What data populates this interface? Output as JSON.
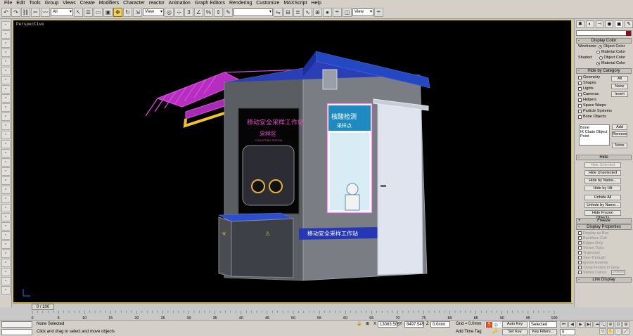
{
  "menu": [
    "File",
    "Edit",
    "Tools",
    "Group",
    "Views",
    "Create",
    "Modifiers",
    "Character",
    "reactor",
    "Animation",
    "Graph Editors",
    "Rendering",
    "Customize",
    "MAXScript",
    "Help"
  ],
  "toolbar": {
    "filter_value": "All",
    "refcoord_value": "View",
    "named_selection_value": "",
    "view_dropdown2": "View"
  },
  "viewport": {
    "label": "Perspective",
    "model": {
      "poster_left_title": "移动安全采样工作站",
      "poster_left_sub": "采样区",
      "poster_left_small": "COLLECTING STATION",
      "poster_right_title": "核酸检测",
      "poster_right_sub": "采样点",
      "banner_text": "移动安全采样工作站"
    }
  },
  "right_panel": {
    "display_color": {
      "header": "Display Color",
      "wireframe_label": "Wireframe:",
      "shaded_label": "Shaded:",
      "opt_object": "Object Color",
      "opt_material": "Material Color"
    },
    "hide_by_category": {
      "header": "Hide by Category",
      "items": [
        {
          "label": "Geometry",
          "checked": false
        },
        {
          "label": "Shapes",
          "checked": false
        },
        {
          "label": "Lights",
          "checked": false
        },
        {
          "label": "Cameras",
          "checked": false
        },
        {
          "label": "Helpers",
          "checked": false
        },
        {
          "label": "Space Warps",
          "checked": false
        },
        {
          "label": "Particle Systems",
          "checked": false
        },
        {
          "label": "Bone Objects",
          "checked": false
        }
      ],
      "btn_all": "All",
      "btn_none": "None",
      "btn_invert": "Invert",
      "list": [
        "Bone",
        "IK Chain Object",
        "Point"
      ],
      "btn_add": "Add",
      "btn_remove": "Remove",
      "btn_none2": "None"
    },
    "hide": {
      "header": "Hide",
      "buttons": [
        "Hide Selected",
        "Hide Unselected",
        "Hide by Name...",
        "Hide by Hit",
        "Unhide All",
        "Unhide by Name...",
        "Hide Frozen Objects"
      ]
    },
    "freeze_header": "Freeze",
    "display_properties": {
      "header": "Display Properties",
      "items": [
        {
          "label": "Display as Box",
          "checked": false
        },
        {
          "label": "Backface Cull",
          "checked": true
        },
        {
          "label": "Edges Only",
          "checked": true
        },
        {
          "label": "Vertex Ticks",
          "checked": false
        },
        {
          "label": "Trajectory",
          "checked": false
        },
        {
          "label": "See-Through",
          "checked": false
        },
        {
          "label": "Ignore Extents",
          "checked": false
        },
        {
          "label": "Show Frozen in Gray",
          "checked": true
        },
        {
          "label": "Vertex Colors",
          "checked": false
        }
      ],
      "btn_shaded": "Shaded"
    },
    "link_display_header": "Link Display"
  },
  "timeline": {
    "slider_label": "0 / 100",
    "ticks": [
      "0",
      "5",
      "10",
      "15",
      "20",
      "25",
      "30",
      "35",
      "40",
      "45",
      "50",
      "55",
      "60",
      "65",
      "70",
      "75",
      "80",
      "85",
      "90",
      "95",
      "100"
    ]
  },
  "status": {
    "selection": "None Selected",
    "prompt": "Click and drag to select and move objects",
    "x_label": "X",
    "x_value": "13063.505",
    "y_label": "Y",
    "y_value": "8497.545",
    "z_label": "Z",
    "z_value": "0.0mm",
    "grid": "Grid = 0.0mm",
    "add_time_tag": "Add Time Tag",
    "auto_key": "Auto Key",
    "set_key": "Set Key",
    "key_mode": "Selected",
    "key_filters": "Key Filters...",
    "frame_value": "0"
  }
}
